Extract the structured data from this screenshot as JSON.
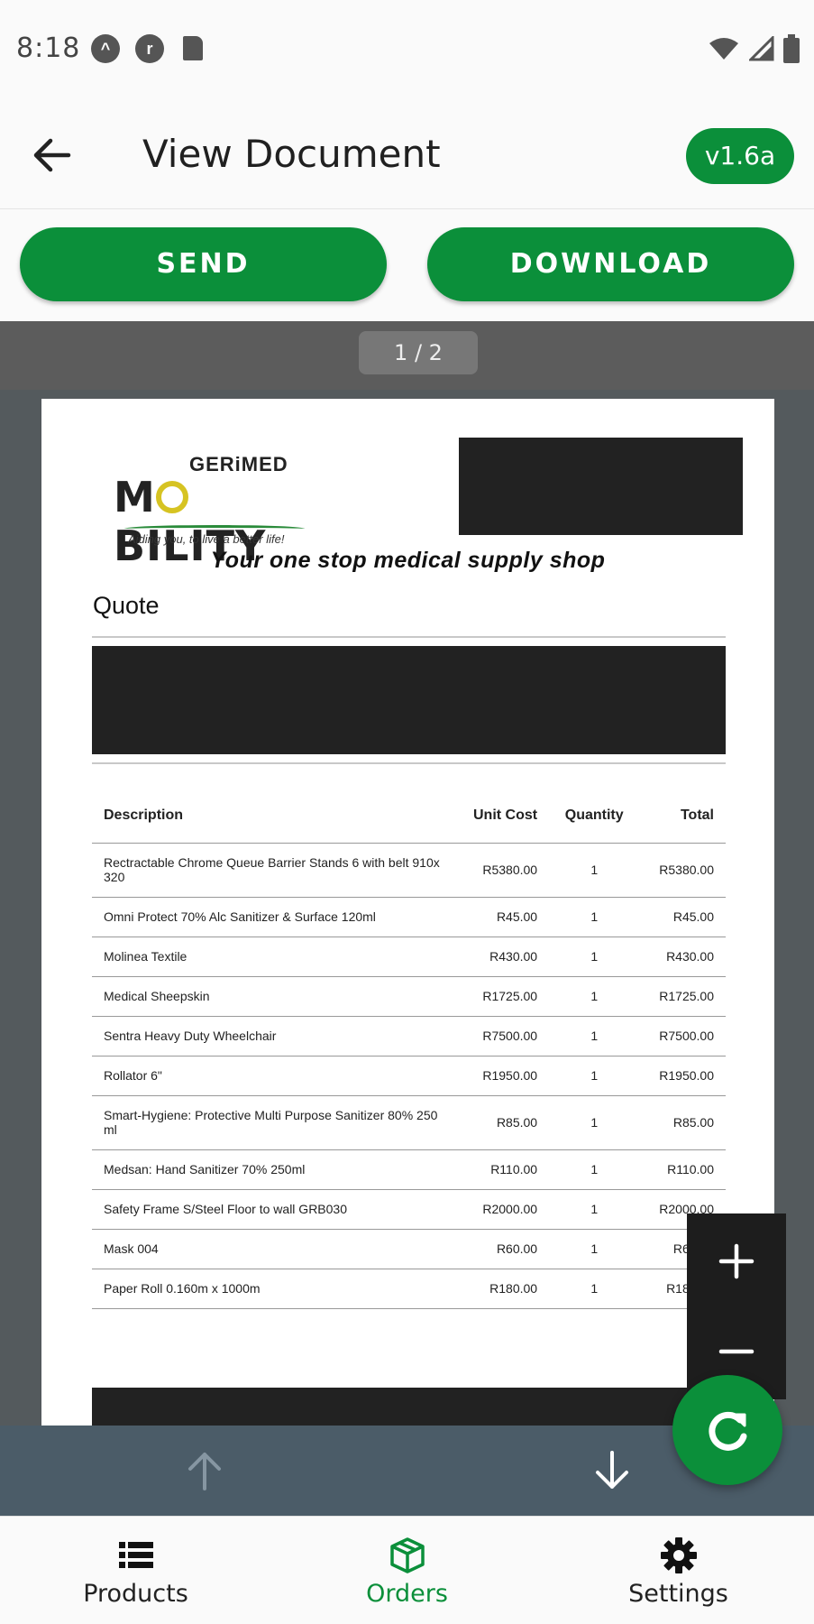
{
  "status_bar": {
    "time": "8:18"
  },
  "app_bar": {
    "title": "View Document",
    "version": "v1.6a"
  },
  "actions": {
    "send_label": "SEND",
    "download_label": "DOWNLOAD"
  },
  "viewer": {
    "page_indicator": "1 / 2"
  },
  "document": {
    "logo": {
      "top": "GERiMED",
      "main_start": "M",
      "main_end": "BILITY",
      "tagline": "Aiding you, to live a better life!"
    },
    "tagline": "Your one stop medical supply shop",
    "heading": "Quote",
    "table": {
      "headers": {
        "description": "Description",
        "unit_cost": "Unit Cost",
        "quantity": "Quantity",
        "total": "Total"
      },
      "rows": [
        {
          "description": "Rectractable Chrome Queue Barrier Stands 6 with belt 910x 320",
          "unit_cost": "R5380.00",
          "quantity": "1",
          "total": "R5380.00"
        },
        {
          "description": "Omni Protect 70% Alc Sanitizer & Surface 120ml",
          "unit_cost": "R45.00",
          "quantity": "1",
          "total": "R45.00"
        },
        {
          "description": "Molinea Textile",
          "unit_cost": "R430.00",
          "quantity": "1",
          "total": "R430.00"
        },
        {
          "description": "Medical Sheepskin",
          "unit_cost": "R1725.00",
          "quantity": "1",
          "total": "R1725.00"
        },
        {
          "description": "Sentra Heavy Duty Wheelchair",
          "unit_cost": "R7500.00",
          "quantity": "1",
          "total": "R7500.00"
        },
        {
          "description": "Rollator 6\"",
          "unit_cost": "R1950.00",
          "quantity": "1",
          "total": "R1950.00"
        },
        {
          "description": "Smart-Hygiene: Protective Multi Purpose Sanitizer 80% 250 ml",
          "unit_cost": "R85.00",
          "quantity": "1",
          "total": "R85.00"
        },
        {
          "description": "Medsan: Hand Sanitizer 70% 250ml",
          "unit_cost": "R110.00",
          "quantity": "1",
          "total": "R110.00"
        },
        {
          "description": "Safety Frame S/Steel Floor to wall GRB030",
          "unit_cost": "R2000.00",
          "quantity": "1",
          "total": "R2000.00"
        },
        {
          "description": "Mask 004",
          "unit_cost": "R60.00",
          "quantity": "1",
          "total": "R60.00"
        },
        {
          "description": "Paper Roll 0.160m x 1000m",
          "unit_cost": "R180.00",
          "quantity": "1",
          "total": "R180.00"
        }
      ]
    }
  },
  "bottom_nav": {
    "items": [
      {
        "label": "Products",
        "icon": "list-icon"
      },
      {
        "label": "Orders",
        "icon": "package-icon"
      },
      {
        "label": "Settings",
        "icon": "gear-icon"
      }
    ],
    "active": "Orders"
  },
  "colors": {
    "accent": "#0b8f3a",
    "viewer_bg": "#545a5d",
    "nav_bar": "#4b5c68"
  }
}
